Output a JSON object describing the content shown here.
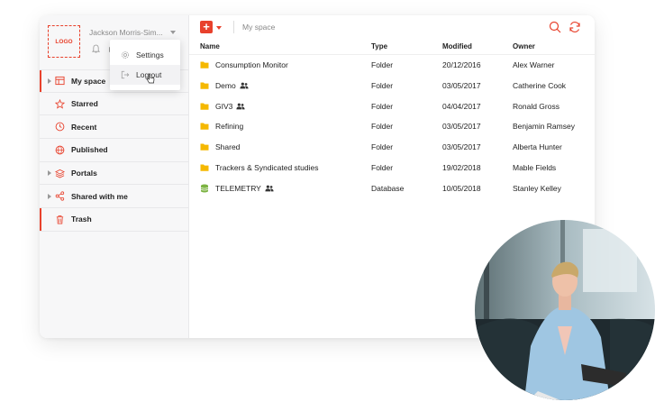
{
  "sidebar": {
    "logo": "LOGO",
    "username": "Jackson Morris-Sim...",
    "items": [
      {
        "label": "My space",
        "icon": "table-icon"
      },
      {
        "label": "Starred",
        "icon": "star-icon"
      },
      {
        "label": "Recent",
        "icon": "clock-icon"
      },
      {
        "label": "Published",
        "icon": "globe-icon"
      },
      {
        "label": "Portals",
        "icon": "layers-icon"
      },
      {
        "label": "Shared with me",
        "icon": "share-icon"
      },
      {
        "label": "Trash",
        "icon": "trash-icon"
      }
    ]
  },
  "user_menu": {
    "items": [
      {
        "label": "Settings",
        "icon": "gear-icon"
      },
      {
        "label": "Log out",
        "icon": "logout-icon"
      }
    ]
  },
  "toolbar": {
    "add_label": "+",
    "breadcrumb": "My space"
  },
  "table": {
    "columns": [
      "Name",
      "Type",
      "Modified",
      "Owner"
    ],
    "rows": [
      {
        "name": "Consumption Monitor",
        "type": "Folder",
        "modified": "20/12/2016",
        "owner": "Alex Warner",
        "shared": false
      },
      {
        "name": "Demo",
        "type": "Folder",
        "modified": "03/05/2017",
        "owner": "Catherine Cook",
        "shared": true
      },
      {
        "name": "GIV3",
        "type": "Folder",
        "modified": "04/04/2017",
        "owner": "Ronald Gross",
        "shared": true
      },
      {
        "name": "Refining",
        "type": "Folder",
        "modified": "03/05/2017",
        "owner": "Benjamin Ramsey",
        "shared": false
      },
      {
        "name": "Shared",
        "type": "Folder",
        "modified": "03/05/2017",
        "owner": "Alberta Hunter",
        "shared": false
      },
      {
        "name": "Trackers & Syndicated studies",
        "type": "Folder",
        "modified": "19/02/2018",
        "owner": "Mable Fields",
        "shared": false
      },
      {
        "name": "TELEMETRY",
        "type": "Database",
        "modified": "10/05/2018",
        "owner": "Stanley Kelley",
        "shared": true
      }
    ]
  },
  "colors": {
    "accent": "#e8412c",
    "folder": "#f5b800",
    "database": "#7cb342"
  }
}
